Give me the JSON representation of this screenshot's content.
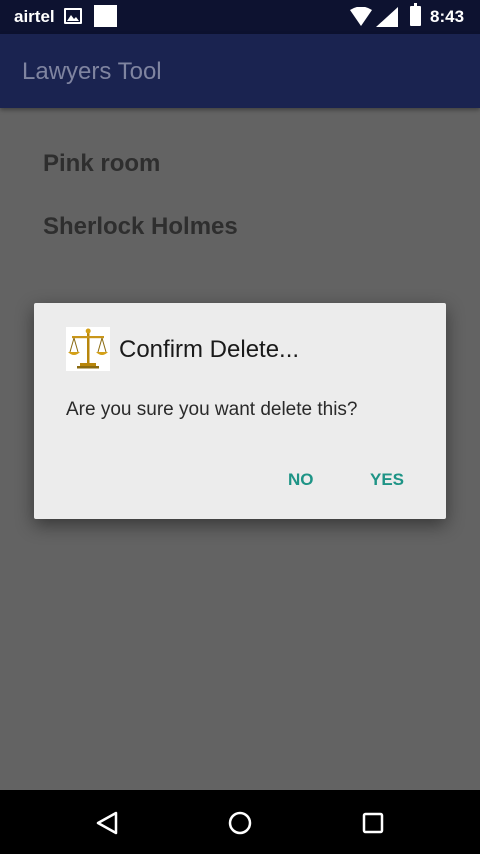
{
  "status_bar": {
    "carrier": "airtel",
    "time": "8:43",
    "icons": [
      "gallery-icon",
      "notification-square-icon",
      "wifi-icon",
      "signal-icon",
      "battery-icon"
    ]
  },
  "app_bar": {
    "title": "Lawyers Tool"
  },
  "list": {
    "items": [
      {
        "label": "Pink room"
      },
      {
        "label": "Sherlock Holmes"
      }
    ]
  },
  "dialog": {
    "icon": "scales-of-justice-icon",
    "title": "Confirm Delete...",
    "message": "Are you sure you want delete this?",
    "negative_label": "NO",
    "positive_label": "YES"
  },
  "nav_bar": {
    "icons": [
      "back-icon",
      "home-icon",
      "recents-icon"
    ]
  },
  "colors": {
    "app_bar": "#1a2350",
    "status_bar": "#0d1230",
    "dialog_button": "#1e9486",
    "scrim": "#636363"
  }
}
